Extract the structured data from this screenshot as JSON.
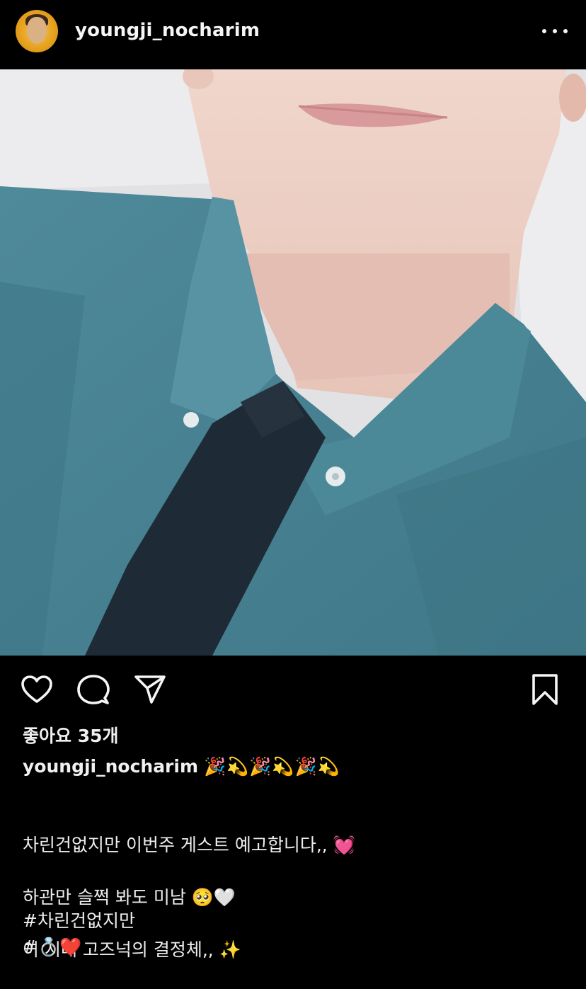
{
  "header": {
    "username": "youngji_nocharim",
    "avatar_icon": "profile-avatar",
    "more_icon": "more-horizontal-icon"
  },
  "post": {
    "image_description_icon": "post-photo"
  },
  "actions": {
    "like_icon": "heart-icon",
    "comment_icon": "comment-bubble-icon",
    "share_icon": "paper-plane-icon",
    "save_icon": "bookmark-icon"
  },
  "likes": {
    "text": "좋아요 35개"
  },
  "caption": {
    "username": "youngji_nocharim",
    "emojis": "🎉💫🎉💫🎉💫",
    "line1": "차린건없지만 이번주 게스트 예고합니다,, 💓",
    "line2": "하관만 슬쩍 봐도 미남 🥺🤍",
    "line3": "이 시대 고즈넉의 결정체,, ✨"
  },
  "hashtags": {
    "tag1": "#차린건없지만",
    "tag2": "#💍❤️"
  },
  "colors": {
    "background": "#000000",
    "text": "#f0f0f0"
  }
}
